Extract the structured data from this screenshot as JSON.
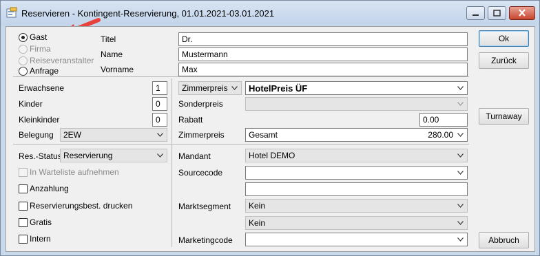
{
  "window": {
    "title": "Reservieren - Kontingent-Reservierung, 01.01.2021-03.01.2021"
  },
  "guest_type": {
    "options": [
      "Gast",
      "Firma",
      "Reiseveranstalter",
      "Anfrage"
    ],
    "selected": "Gast"
  },
  "guest": {
    "titel_label": "Titel",
    "titel_value": "Dr.",
    "name_label": "Name",
    "name_value": "Mustermann",
    "vorname_label": "Vorname",
    "vorname_value": "Max"
  },
  "persons": {
    "erwachsene_label": "Erwachsene",
    "erwachsene_value": "1",
    "kinder_label": "Kinder",
    "kinder_value": "0",
    "kleinkinder_label": "Kleinkinder",
    "kleinkinder_value": "0",
    "belegung_label": "Belegung",
    "belegung_value": "2EW"
  },
  "pricing": {
    "price_type_value": "Zimmerpreis",
    "price_value": "HotelPreis ÜF",
    "sonderpreis_label": "Sonderpreis",
    "sonderpreis_value": "",
    "rabatt_label": "Rabatt",
    "rabatt_value": "0.00",
    "zimmerpreis_label": "Zimmerpreis",
    "zimmerpreis_mode": "Gesamt",
    "zimmerpreis_amount": "280.00"
  },
  "status": {
    "label": "Res.-Status",
    "value": "Reservierung",
    "warteliste_label": "In Warteliste aufnehmen",
    "anzahlung_label": "Anzahlung",
    "druck_label": "Reservierungsbest. drucken",
    "gratis_label": "Gratis",
    "intern_label": "Intern"
  },
  "booking": {
    "mandant_label": "Mandant",
    "mandant_value": "Hotel DEMO",
    "sourcecode_label": "Sourcecode",
    "sourcecode_value": "",
    "sourcecode_extra": "",
    "marktsegment_label": "Marktsegment",
    "marktsegment_value": "Kein",
    "marktsegment_value2": "Kein",
    "marketingcode_label": "Marketingcode",
    "marketingcode_value": ""
  },
  "buttons": {
    "ok": "Ok",
    "zurueck": "Zurück",
    "turnaway": "Turnaway",
    "abbruch": "Abbruch"
  },
  "colors": {
    "arrow": "#e8413a",
    "titlebar": "#c9d9ec"
  }
}
